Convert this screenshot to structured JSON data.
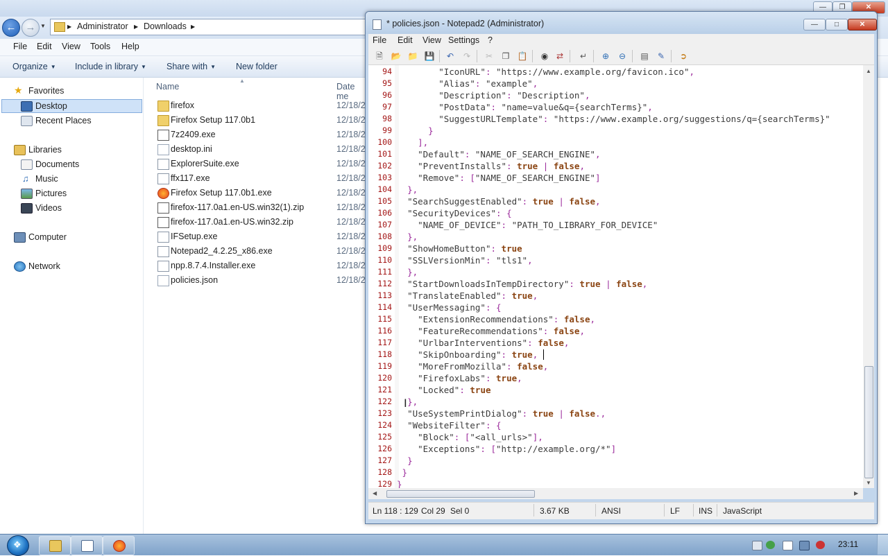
{
  "explorer": {
    "address": {
      "crumbs": [
        "Administrator",
        "Downloads"
      ]
    },
    "menu": [
      "File",
      "Edit",
      "View",
      "Tools",
      "Help"
    ],
    "commands": {
      "organize": "Organize",
      "include": "Include in library",
      "share": "Share with",
      "new_folder": "New folder"
    },
    "nav": {
      "favorites": "Favorites",
      "desktop": "Desktop",
      "recent": "Recent Places",
      "libraries": "Libraries",
      "documents": "Documents",
      "music": "Music",
      "pictures": "Pictures",
      "videos": "Videos",
      "computer": "Computer",
      "network": "Network"
    },
    "columns": {
      "name": "Name",
      "date": "Date me"
    },
    "files": [
      {
        "name": "firefox",
        "date": "12/18/2",
        "icon": "folder-icon"
      },
      {
        "name": "Firefox Setup 117.0b1",
        "date": "12/18/2",
        "icon": "folder-icon"
      },
      {
        "name": "7z2409.exe",
        "date": "12/18/2",
        "icon": "7zip-icon"
      },
      {
        "name": "desktop.ini",
        "date": "12/18/2",
        "icon": "settings-file-icon"
      },
      {
        "name": "ExplorerSuite.exe",
        "date": "12/18/2",
        "icon": "exe-icon"
      },
      {
        "name": "ffx117.exe",
        "date": "12/18/2",
        "icon": "exe-icon"
      },
      {
        "name": "Firefox Setup 117.0b1.exe",
        "date": "12/18/2",
        "icon": "installer-icon"
      },
      {
        "name": "firefox-117.0a1.en-US.win32(1).zip",
        "date": "12/18/2",
        "icon": "zip-icon"
      },
      {
        "name": "firefox-117.0a1.en-US.win32.zip",
        "date": "12/18/2",
        "icon": "zip-icon"
      },
      {
        "name": "IFSetup.exe",
        "date": "12/18/2",
        "icon": "exe-icon"
      },
      {
        "name": "Notepad2_4.2.25_x86.exe",
        "date": "12/18/2",
        "icon": "exe-icon"
      },
      {
        "name": "npp.8.7.4.Installer.exe",
        "date": "12/18/2",
        "icon": "npp-icon"
      },
      {
        "name": "policies.json",
        "date": "12/18/2",
        "icon": "file-icon"
      }
    ]
  },
  "notepad": {
    "title": "* policies.json - Notepad2 (Administrator)",
    "menu": [
      "File",
      "Edit",
      "View",
      "Settings",
      "?"
    ],
    "lines": [
      {
        "n": "94",
        "t": "        \"IconURL\": \"https://www.example.org/favicon.ico\","
      },
      {
        "n": "95",
        "t": "        \"Alias\": \"example\","
      },
      {
        "n": "96",
        "t": "        \"Description\": \"Description\","
      },
      {
        "n": "97",
        "t": "        \"PostData\": \"name=value&q={searchTerms}\","
      },
      {
        "n": "98",
        "t": "        \"SuggestURLTemplate\": \"https://www.example.org/suggestions/q={searchTerms}\""
      },
      {
        "n": "99",
        "t": "      }"
      },
      {
        "n": "100",
        "t": "    ],"
      },
      {
        "n": "101",
        "t": "    \"Default\": \"NAME_OF_SEARCH_ENGINE\","
      },
      {
        "n": "102",
        "t": "    \"PreventInstalls\": true | false,"
      },
      {
        "n": "103",
        "t": "    \"Remove\": [\"NAME_OF_SEARCH_ENGINE\"]"
      },
      {
        "n": "104",
        "t": "  },"
      },
      {
        "n": "105",
        "t": "  \"SearchSuggestEnabled\": true | false,"
      },
      {
        "n": "106",
        "t": "  \"SecurityDevices\": {"
      },
      {
        "n": "107",
        "t": "    \"NAME_OF_DEVICE\": \"PATH_TO_LIBRARY_FOR_DEVICE\""
      },
      {
        "n": "108",
        "t": "  },"
      },
      {
        "n": "109",
        "t": "  \"ShowHomeButton\": true"
      },
      {
        "n": "110",
        "t": "  \"SSLVersionMin\": \"tls1\","
      },
      {
        "n": "111",
        "t": "  },"
      },
      {
        "n": "112",
        "t": "  \"StartDownloadsInTempDirectory\": true | false,"
      },
      {
        "n": "113",
        "t": "  \"TranslateEnabled\": true,"
      },
      {
        "n": "114",
        "t": "  \"UserMessaging\": {"
      },
      {
        "n": "115",
        "t": "    \"ExtensionRecommendations\": false,"
      },
      {
        "n": "116",
        "t": "    \"FeatureRecommendations\": false,"
      },
      {
        "n": "117",
        "t": "    \"UrlbarInterventions\": false,"
      },
      {
        "n": "118",
        "t": "    \"SkipOnboarding\": true,"
      },
      {
        "n": "119",
        "t": "    \"MoreFromMozilla\": false,"
      },
      {
        "n": "120",
        "t": "    \"FirefoxLabs\": true,"
      },
      {
        "n": "121",
        "t": "    \"Locked\": true"
      },
      {
        "n": "122",
        "t": "  },"
      },
      {
        "n": "123",
        "t": "  \"UseSystemPrintDialog\": true | false.,"
      },
      {
        "n": "124",
        "t": "  \"WebsiteFilter\": {"
      },
      {
        "n": "125",
        "t": "    \"Block\": [\"<all_urls>\"],"
      },
      {
        "n": "126",
        "t": "    \"Exceptions\": [\"http://example.org/*\"]"
      },
      {
        "n": "127",
        "t": "  }"
      },
      {
        "n": "128",
        "t": " }"
      },
      {
        "n": "129",
        "t": "}"
      }
    ],
    "status": {
      "pos": "Ln 118 : 129",
      "col": "Col 29",
      "sel": "Sel 0",
      "size": "3.67 KB",
      "enc": "ANSI",
      "eol": "LF",
      "mode": "INS",
      "lang": "JavaScript"
    }
  },
  "taskbar": {
    "clock": "23:11"
  },
  "colors": {
    "keyword": "#8b4513",
    "punct": "#9b2a9b",
    "linenum": "#a31515",
    "selection": "#cfe2f8"
  }
}
